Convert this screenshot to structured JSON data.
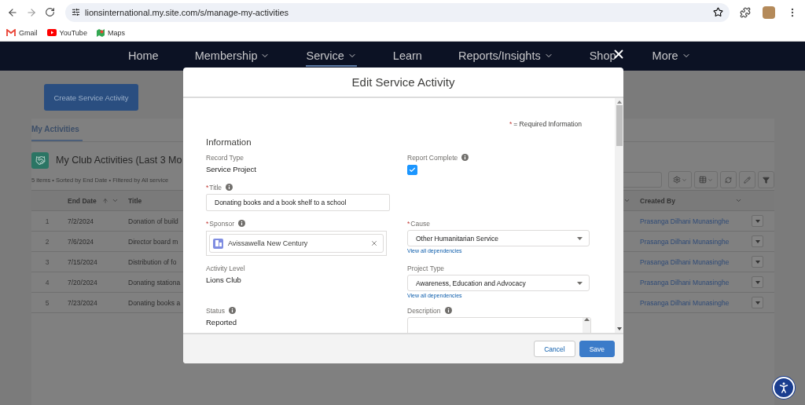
{
  "browser": {
    "url": "lionsinternational.my.site.com/s/manage-my-activities",
    "bookmarks": [
      {
        "kind": "gmail",
        "label": "Gmail"
      },
      {
        "kind": "youtube",
        "label": "YouTube"
      },
      {
        "kind": "maps",
        "label": "Maps"
      }
    ]
  },
  "nav": {
    "items": [
      {
        "label": "Home",
        "dropdown": false,
        "selected": false
      },
      {
        "label": "Membership",
        "dropdown": true,
        "selected": false
      },
      {
        "label": "Service",
        "dropdown": true,
        "selected": true
      },
      {
        "label": "Learn",
        "dropdown": false,
        "selected": false
      },
      {
        "label": "Reports/Insights",
        "dropdown": true,
        "selected": false
      },
      {
        "label": "Shop",
        "dropdown": false,
        "selected": false
      },
      {
        "label": "More",
        "dropdown": true,
        "selected": false
      }
    ]
  },
  "page": {
    "create_button": "Create Service Activity",
    "tabs": [
      {
        "label": "My Activities",
        "selected": true
      }
    ],
    "list": {
      "title": "My Club Activities (Last 3 Mo",
      "meta": "5 items • Sorted by End Date • Filtered by All service",
      "columns": [
        {
          "label": "End Date",
          "sorted": true
        },
        {
          "label": "Title",
          "sorted": false
        },
        {
          "label": "Created By",
          "sorted": false
        }
      ],
      "rows": [
        {
          "number": "1",
          "end_date": "7/2/2024",
          "title": "Donation of build",
          "created_by": "Prasanga Dilhani Munasinghe"
        },
        {
          "number": "2",
          "end_date": "7/6/2024",
          "title": "Director board m",
          "created_by": "Prasanga Dilhani Munasinghe"
        },
        {
          "number": "3",
          "end_date": "7/15/2024",
          "title": "Distribution of fo",
          "created_by": "Prasanga Dilhani Munasinghe"
        },
        {
          "number": "4",
          "end_date": "7/20/2024",
          "title": "Donating stationa",
          "created_by": "Prasanga Dilhani Munasinghe"
        },
        {
          "number": "5",
          "end_date": "7/23/2024",
          "title": "Donating books a",
          "created_by": "Prasanga Dilhani Munasinghe"
        }
      ]
    }
  },
  "modal": {
    "title": "Edit Service Activity",
    "required_legend": {
      "marker": "*",
      "text": "= Required Information"
    },
    "section": "Information",
    "rows": [
      {
        "left": {
          "kind": "readonly",
          "label": "Record Type",
          "value": "Service Project",
          "required": false,
          "info": false
        },
        "right": {
          "kind": "checkbox",
          "label": "Report Complete",
          "checked": true,
          "required": false,
          "info": true
        }
      },
      {
        "left": {
          "kind": "text",
          "label": "Title",
          "value": "Donating books and a book shelf to a school",
          "required": true,
          "info": true
        }
      },
      {
        "left": {
          "kind": "lookup",
          "label": "Sponsor",
          "value": "Avissawella New Century",
          "required": true,
          "info": true
        },
        "right": {
          "kind": "select",
          "label": "Cause",
          "value": "Other Humanitarian Service",
          "link": "View all dependencies",
          "required": true,
          "info": false
        }
      },
      {
        "left": {
          "kind": "readonly",
          "label": "Activity Level",
          "value": "Lions Club",
          "required": false,
          "info": false
        },
        "right": {
          "kind": "select",
          "label": "Project Type",
          "value": "Awareness, Education and Advocacy",
          "link": "View all dependencies",
          "required": false,
          "info": false
        }
      },
      {
        "left": {
          "kind": "readonly",
          "label": "Status",
          "value": "Reported",
          "required": false,
          "info": true
        },
        "right": {
          "kind": "textarea",
          "label": "Description",
          "required": false,
          "info": true
        }
      }
    ],
    "buttons": [
      {
        "label": "Cancel",
        "kind": "neutral"
      },
      {
        "label": "Save",
        "kind": "brand"
      }
    ]
  }
}
